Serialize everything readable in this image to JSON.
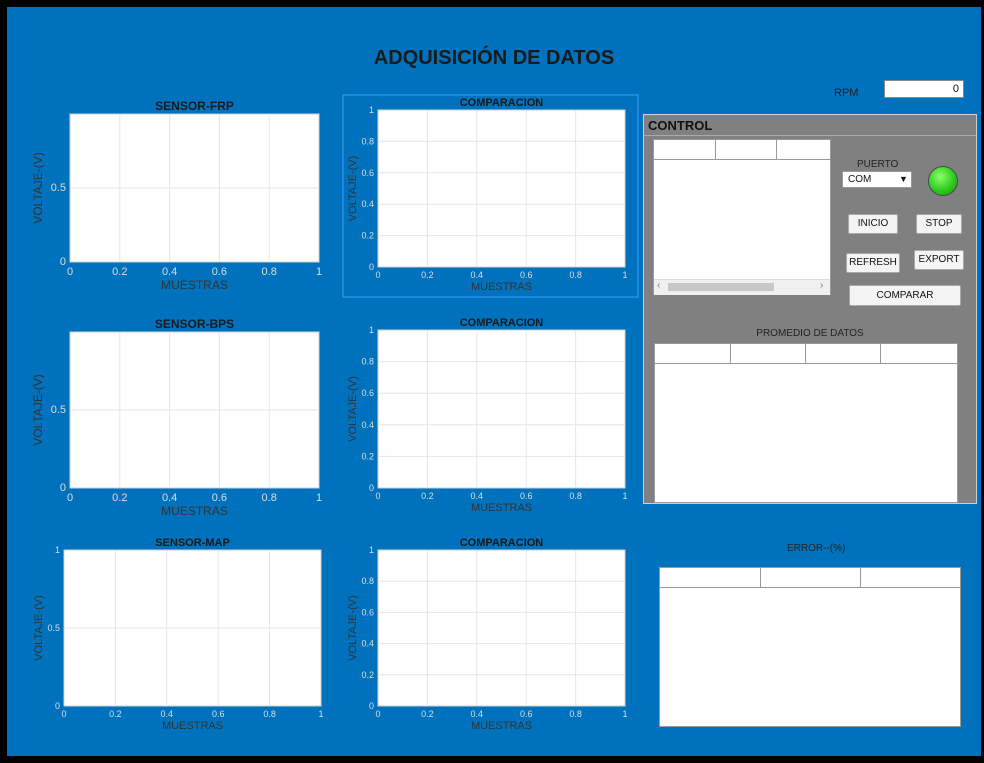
{
  "title": "ADQUISICIÓN DE DATOS",
  "rpm": {
    "label": "RPM",
    "value": "0"
  },
  "axes": [
    {
      "title": "SENSOR-FRP",
      "xlabel": "MUESTRAS",
      "ylabel": "VOLTAJE-(V)",
      "xticks": [
        "0",
        "0.2",
        "0.4",
        "0.6",
        "0.8",
        "1"
      ],
      "yticks": [
        "0",
        "0.5"
      ]
    },
    {
      "title": "COMPARACION",
      "xlabel": "MUESTRAS",
      "ylabel": "VOLTAJE-(V)",
      "xticks": [
        "0",
        "0.2",
        "0.4",
        "0.6",
        "0.8",
        "1"
      ],
      "yticks": [
        "0",
        "0.2",
        "0.4",
        "0.6",
        "0.8",
        "1"
      ]
    },
    {
      "title": "SENSOR-BPS",
      "xlabel": "MUESTRAS",
      "ylabel": "VOLTAJE-(V)",
      "xticks": [
        "0",
        "0.2",
        "0.4",
        "0.6",
        "0.8",
        "1"
      ],
      "yticks": [
        "0",
        "0.5"
      ]
    },
    {
      "title": "COMPARACION",
      "xlabel": "MUESTRAS",
      "ylabel": "VOLTAJE-(V)",
      "xticks": [
        "0",
        "0.2",
        "0.4",
        "0.6",
        "0.8",
        "1"
      ],
      "yticks": [
        "0",
        "0.2",
        "0.4",
        "0.6",
        "0.8",
        "1"
      ]
    },
    {
      "title": "SENSOR-MAP",
      "xlabel": "MUESTRAS",
      "ylabel": "VOLTAJE-(V)",
      "xticks": [
        "0",
        "0.2",
        "0.4",
        "0.6",
        "0.8",
        "1"
      ],
      "yticks": [
        "0",
        "0.5",
        "1"
      ]
    },
    {
      "title": "COMPARACION",
      "xlabel": "MUESTRAS",
      "ylabel": "VOLTAJE-(V)",
      "xticks": [
        "0",
        "0.2",
        "0.4",
        "0.6",
        "0.8",
        "1"
      ],
      "yticks": [
        "0",
        "0.2",
        "0.4",
        "0.6",
        "0.8",
        "1"
      ]
    }
  ],
  "control": {
    "title": "CONTROL",
    "port_label": "PUERTO",
    "port_value": "COM",
    "port_arrow": "▼",
    "status_led": "on",
    "buttons": {
      "inicio": "INICIO",
      "stop": "STOP",
      "refresh": "REFRESH",
      "export": "EXPORT",
      "comparar": "COMPARAR"
    },
    "scroll_left": "‹",
    "scroll_right": "›",
    "averages_label": "PROMEDIO DE DATOS"
  },
  "error_label": "ERROR--(%)",
  "colors": {
    "background": "#0072BD",
    "panel": "#808080",
    "led": "#2ecc1f",
    "grid": "#e6e6e6"
  }
}
